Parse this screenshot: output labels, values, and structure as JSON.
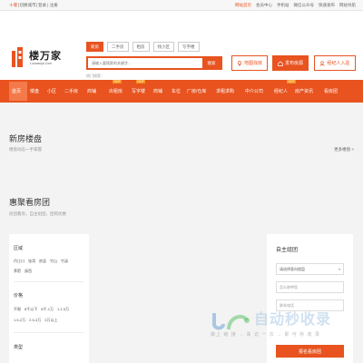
{
  "topbar": {
    "city": "十堰",
    "switch_city": "[切换城市]",
    "login": "登录",
    "register": "注册",
    "links": [
      "网站首页",
      "会员中心",
      "手机站",
      "微信公众号",
      "快速发布",
      "网站导航"
    ]
  },
  "header": {
    "logo_text": "楼万家",
    "logo_sub": "Louwanjia.Com",
    "search_tabs": [
      "新房",
      "二手房",
      "租房",
      "找小区",
      "写字楼"
    ],
    "search_placeholder": "请输入要搜索的关键字...",
    "search_button": "搜索",
    "hot_search": "热门搜索：",
    "btn_map": "地图找房",
    "btn_publish": "发布房源",
    "btn_agent": "经纪人入驻"
  },
  "nav": {
    "items": [
      "首页",
      "楼盘",
      "小区",
      "二手房",
      "商铺",
      "出租房",
      "写字楼",
      "商铺",
      "车位",
      "厂房/仓库",
      "求租求购",
      "中介公司",
      "经纪人",
      "房产资讯",
      "看房团"
    ],
    "hot": "HOT"
  },
  "section_new": {
    "title": "新房楼盘",
    "subtitle": "楼盘动态一手掌握",
    "more": "更多楼盘"
  },
  "section_tour": {
    "title": "惠聚看房团",
    "subtitle": "房团看房，自主组团，团购优惠"
  },
  "filter": {
    "area_label": "区域",
    "areas_row1": [
      "丹江口",
      "张湾",
      "房县",
      "竹山",
      "竹溪"
    ],
    "areas_row2": [
      "茅箭",
      "郧西"
    ],
    "price_label": "价格",
    "prices_row1": [
      "不限",
      "8千以下",
      "8千-1万",
      "1-1.5万"
    ],
    "prices_row2": [
      "1.5-2万",
      "2.5-3万",
      "3万以上"
    ],
    "type_label": "类型"
  },
  "form": {
    "title": "自主组团",
    "select_placeholder": "请选择意向楼盘",
    "name_placeholder": "怎么称呼您",
    "phone_placeholder": "联系电话",
    "submit": "报名看房团"
  },
  "watermark": {
    "text": "自动秒收录",
    "sub": "做上 链 接 → 来 访 一 次 → 即 可 秒 收 录"
  },
  "colors": {
    "brand": "#e8531f",
    "badge": "#f7931e"
  }
}
